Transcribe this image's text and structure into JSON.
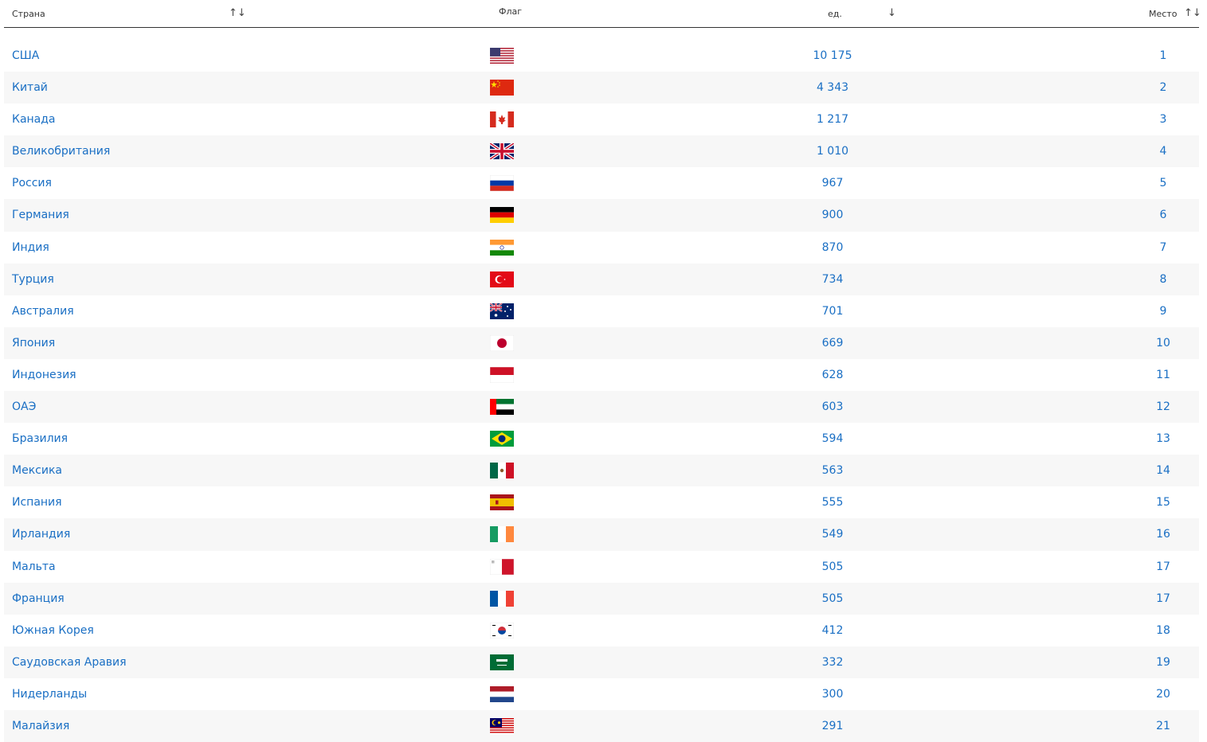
{
  "header": {
    "country_label": "Страна",
    "flag_label": "Флаг",
    "value_label": "ед.",
    "rank_label": "Место",
    "sort_both_glyph": "↑↓",
    "sort_desc_glyph": "↓"
  },
  "rows": [
    {
      "country": "США",
      "flag": "us-flag-icon",
      "value": "10 175",
      "rank": "1"
    },
    {
      "country": "Китай",
      "flag": "cn-flag-icon",
      "value": "4 343",
      "rank": "2"
    },
    {
      "country": "Канада",
      "flag": "ca-flag-icon",
      "value": "1 217",
      "rank": "3"
    },
    {
      "country": "Великобритания",
      "flag": "gb-flag-icon",
      "value": "1 010",
      "rank": "4"
    },
    {
      "country": "Россия",
      "flag": "ru-flag-icon",
      "value": "967",
      "rank": "5"
    },
    {
      "country": "Германия",
      "flag": "de-flag-icon",
      "value": "900",
      "rank": "6"
    },
    {
      "country": "Индия",
      "flag": "in-flag-icon",
      "value": "870",
      "rank": "7"
    },
    {
      "country": "Турция",
      "flag": "tr-flag-icon",
      "value": "734",
      "rank": "8"
    },
    {
      "country": "Австралия",
      "flag": "au-flag-icon",
      "value": "701",
      "rank": "9"
    },
    {
      "country": "Япония",
      "flag": "jp-flag-icon",
      "value": "669",
      "rank": "10"
    },
    {
      "country": "Индонезия",
      "flag": "id-flag-icon",
      "value": "628",
      "rank": "11"
    },
    {
      "country": "ОАЭ",
      "flag": "ae-flag-icon",
      "value": "603",
      "rank": "12"
    },
    {
      "country": "Бразилия",
      "flag": "br-flag-icon",
      "value": "594",
      "rank": "13"
    },
    {
      "country": "Мексика",
      "flag": "mx-flag-icon",
      "value": "563",
      "rank": "14"
    },
    {
      "country": "Испания",
      "flag": "es-flag-icon",
      "value": "555",
      "rank": "15"
    },
    {
      "country": "Ирландия",
      "flag": "ie-flag-icon",
      "value": "549",
      "rank": "16"
    },
    {
      "country": "Мальта",
      "flag": "mt-flag-icon",
      "value": "505",
      "rank": "17"
    },
    {
      "country": "Франция",
      "flag": "fr-flag-icon",
      "value": "505",
      "rank": "17"
    },
    {
      "country": "Южная Корея",
      "flag": "kr-flag-icon",
      "value": "412",
      "rank": "18"
    },
    {
      "country": "Саудовская Аравия",
      "flag": "sa-flag-icon",
      "value": "332",
      "rank": "19"
    },
    {
      "country": "Нидерланды",
      "flag": "nl-flag-icon",
      "value": "300",
      "rank": "20"
    },
    {
      "country": "Малайзия",
      "flag": "my-flag-icon",
      "value": "291",
      "rank": "21"
    }
  ]
}
